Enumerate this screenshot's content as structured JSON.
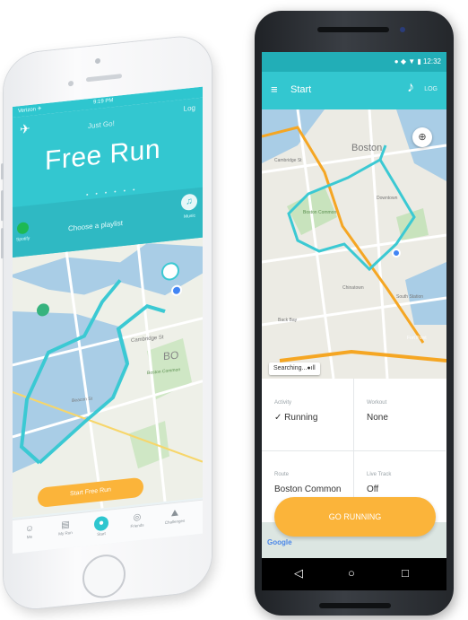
{
  "iphone": {
    "status": {
      "carrier": "Verizon ✈",
      "time": "9:19 PM"
    },
    "header": {
      "subtitle": "Just Go!",
      "log_label": "Log",
      "title": "Free Run",
      "pager_dots": "• • • • • •"
    },
    "playlist": {
      "spotify_label": "Spotify",
      "prompt": "Choose a playlist",
      "music_label": "Music"
    },
    "map": {
      "labels": [
        "Cambridge St",
        "Boston Common",
        "BO",
        "Beacon St"
      ]
    },
    "cta_label": "Start Free Run",
    "tabs": [
      {
        "label": "Me",
        "icon": "smile-icon",
        "glyph": "☺"
      },
      {
        "label": "My Run",
        "icon": "clipboard-icon",
        "glyph": "▤"
      },
      {
        "label": "Start",
        "icon": "location-pin-icon",
        "glyph": "●"
      },
      {
        "label": "Friends",
        "icon": "friends-icon",
        "glyph": "◎"
      },
      {
        "label": "Challenges",
        "icon": "mountain-icon",
        "glyph": "⛰"
      }
    ]
  },
  "android": {
    "status": {
      "icons": "● ◆ ▼ ▮ 12:32"
    },
    "toolbar": {
      "title": "Start",
      "log_label": "LOG",
      "note_glyph": "♪"
    },
    "map": {
      "labels": [
        "Boston",
        "Cambridge St",
        "Boston Common",
        "Downtown",
        "Chinatown",
        "South Station",
        "Fort Point",
        "Back Bay"
      ]
    },
    "searching_label": "Searching...●ıll",
    "settings": [
      {
        "label": "Activity",
        "value": "✓ Running"
      },
      {
        "label": "Workout",
        "value": "None"
      },
      {
        "label": "Route",
        "value": "Boston Common"
      },
      {
        "label": "Live Track",
        "value": "Off"
      }
    ],
    "cta_label": "GO RUNNING",
    "google_label": "Google",
    "nav": {
      "back": "◁",
      "home": "○",
      "recents": "□"
    }
  },
  "colors": {
    "teal": "#33c7d0",
    "teal_dark": "#22aeb7",
    "orange": "#fbb43a",
    "spotify_green": "#1db954"
  }
}
